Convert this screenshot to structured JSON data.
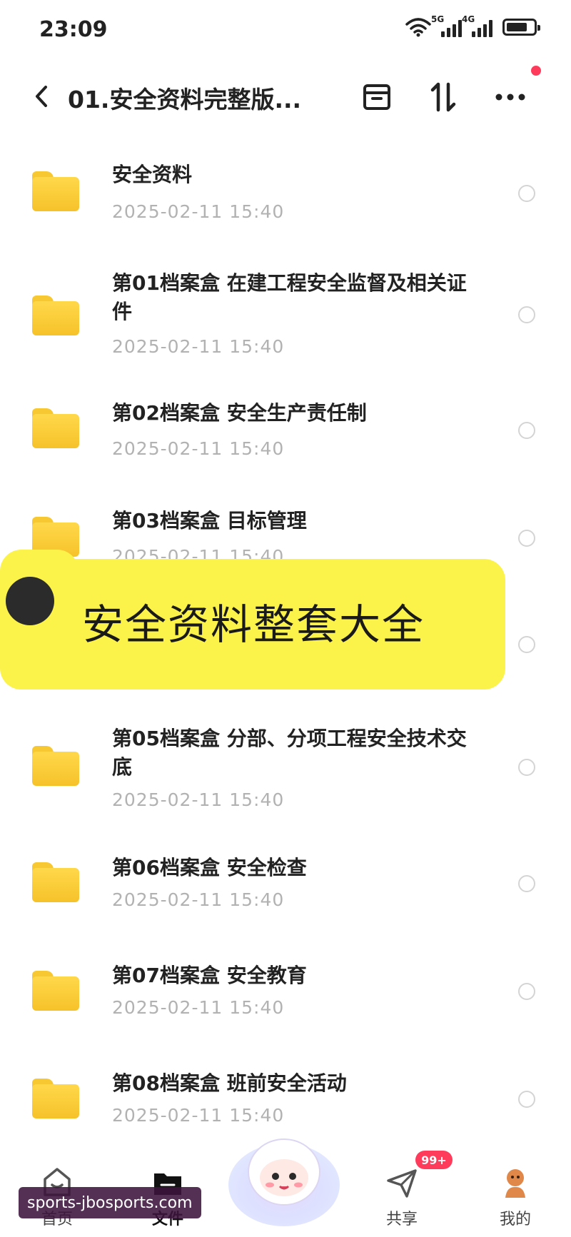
{
  "status_bar": {
    "time": "23:09",
    "network_1": "5G",
    "network_2": "4G"
  },
  "header": {
    "title": "01.安全资料完整版..."
  },
  "files": [
    {
      "name": "安全资料",
      "date": "2025-02-11  15:40"
    },
    {
      "name": "第01档案盒 在建工程安全监督及相关证件",
      "date": "2025-02-11  15:40"
    },
    {
      "name": "第02档案盒 安全生产责任制",
      "date": "2025-02-11  15:40"
    },
    {
      "name": "第03档案盒 目标管理",
      "date": "2025-02-11  15:40"
    },
    {
      "name": "第05档案盒 分部、分项工程安全技术交底",
      "date": "2025-02-11  15:40"
    },
    {
      "name": "第06档案盒 安全检查",
      "date": "2025-02-11  15:40"
    },
    {
      "name": "第07档案盒 安全教育",
      "date": "2025-02-11  15:40"
    },
    {
      "name": "第08档案盒 班前安全活动",
      "date": "2025-02-11  15:40"
    }
  ],
  "banner": {
    "text": "安全资料整套大全"
  },
  "bottom_nav": {
    "items": [
      {
        "label": "首页"
      },
      {
        "label": "文件"
      },
      {
        "label": "共享"
      },
      {
        "label": "我的"
      }
    ],
    "share_badge": "99+"
  },
  "watermark": "sports-jbosports.com",
  "colors": {
    "folder": "#f8c832",
    "banner": "#fbf24a",
    "badge": "#ff3b5c",
    "date_text": "#b2b2b2"
  }
}
